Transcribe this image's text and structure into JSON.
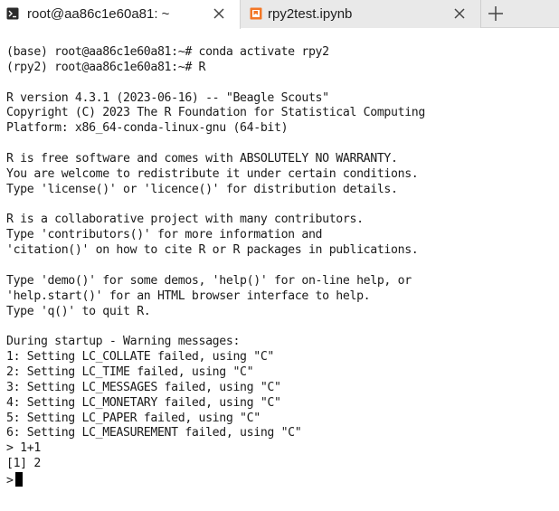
{
  "tabs": [
    {
      "label": "root@aa86c1e60a81: ~",
      "icon": "terminal-icon",
      "active": true
    },
    {
      "label": "rpy2test.ipynb",
      "icon": "notebook-icon",
      "active": false
    }
  ],
  "new_tab_symbol": "+",
  "colors": {
    "tab_bar": "#e9e9e9",
    "terminal_bg": "#ffffff",
    "text": "#1a1a1a",
    "notebook_icon": "#f37726"
  },
  "terminal": {
    "lines": [
      "(base) root@aa86c1e60a81:~# conda activate rpy2",
      "(rpy2) root@aa86c1e60a81:~# R",
      "",
      "R version 4.3.1 (2023-06-16) -- \"Beagle Scouts\"",
      "Copyright (C) 2023 The R Foundation for Statistical Computing",
      "Platform: x86_64-conda-linux-gnu (64-bit)",
      "",
      "R is free software and comes with ABSOLUTELY NO WARRANTY.",
      "You are welcome to redistribute it under certain conditions.",
      "Type 'license()' or 'licence()' for distribution details.",
      "",
      "R is a collaborative project with many contributors.",
      "Type 'contributors()' for more information and",
      "'citation()' on how to cite R or R packages in publications.",
      "",
      "Type 'demo()' for some demos, 'help()' for on-line help, or",
      "'help.start()' for an HTML browser interface to help.",
      "Type 'q()' to quit R.",
      "",
      "During startup - Warning messages:",
      "1: Setting LC_COLLATE failed, using \"C\"",
      "2: Setting LC_TIME failed, using \"C\"",
      "3: Setting LC_MESSAGES failed, using \"C\"",
      "4: Setting LC_MONETARY failed, using \"C\"",
      "5: Setting LC_PAPER failed, using \"C\"",
      "6: Setting LC_MEASUREMENT failed, using \"C\"",
      "> 1+1",
      "[1] 2"
    ],
    "prompt": ">"
  }
}
